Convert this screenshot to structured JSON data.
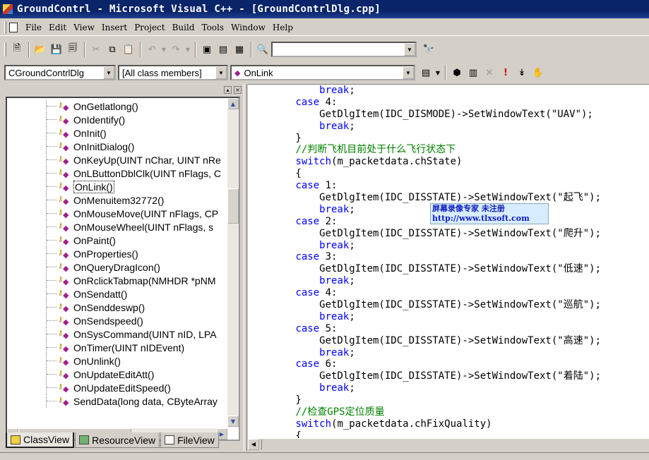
{
  "window": {
    "title": "GroundContrl - Microsoft Visual C++ - [GroundContrlDlg.cpp]"
  },
  "menu": [
    "File",
    "Edit",
    "View",
    "Insert",
    "Project",
    "Build",
    "Tools",
    "Window",
    "Help"
  ],
  "wizard_bar": {
    "class_combo": "CGroundContrlDlg",
    "filter_combo": "[All class members]",
    "member_combo": "OnLink"
  },
  "class_view": {
    "items": [
      "OnGetlatlong()",
      "OnIdentify()",
      "OnInit()",
      "OnInitDialog()",
      "OnKeyUp(UINT nChar, UINT nRe",
      "OnLButtonDblClk(UINT nFlags, C",
      "OnLink()",
      "OnMenuitem32772()",
      "OnMouseMove(UINT nFlags, CP",
      "OnMouseWheel(UINT nFlags, s",
      "OnPaint()",
      "OnProperties()",
      "OnQueryDragIcon()",
      "OnRclickTabmap(NMHDR *pNM",
      "OnSendatt()",
      "OnSenddeswp()",
      "OnSendspeed()",
      "OnSysCommand(UINT nID, LPA",
      "OnTimer(UINT nIDEvent)",
      "OnUnlink()",
      "OnUpdateEditAtt()",
      "OnUpdateEditSpeed()",
      "SendData(long data, CByteArray"
    ],
    "selected": "OnLink()",
    "tabs": [
      "ClassView",
      "ResourceView",
      "FileView"
    ]
  },
  "code": {
    "lines": [
      "            break;",
      "        case 4:",
      "            GetDlgItem(IDC_DISMODE)->SetWindowText(\"UAV\");",
      "            break;",
      "        }",
      "        //判断飞机目前处于什么飞行状态下",
      "        switch(m_packetdata.chState)",
      "        {",
      "        case 1:",
      "            GetDlgItem(IDC_DISSTATE)->SetWindowText(\"起飞\");",
      "            break;",
      "        case 2:",
      "            GetDlgItem(IDC_DISSTATE)->SetWindowText(\"爬升\");",
      "            break;",
      "        case 3:",
      "            GetDlgItem(IDC_DISSTATE)->SetWindowText(\"低速\");",
      "            break;",
      "        case 4:",
      "            GetDlgItem(IDC_DISSTATE)->SetWindowText(\"巡航\");",
      "            break;",
      "        case 5:",
      "            GetDlgItem(IDC_DISSTATE)->SetWindowText(\"高速\");",
      "            break;",
      "        case 6:",
      "            GetDlgItem(IDC_DISSTATE)->SetWindowText(\"着陆\");",
      "            break;",
      "        }",
      "        //检查GPS定位质量",
      "        switch(m_packetdata.chFixQuality)",
      "        {"
    ]
  },
  "watermark": {
    "line1": "屏幕录像专家      未注册",
    "line2": "http://www.tlxsoft.com"
  },
  "colors": {
    "keyword": "#0000ff",
    "comment": "#008000",
    "titlebar": "#0a246a",
    "face": "#d4d0c8"
  }
}
